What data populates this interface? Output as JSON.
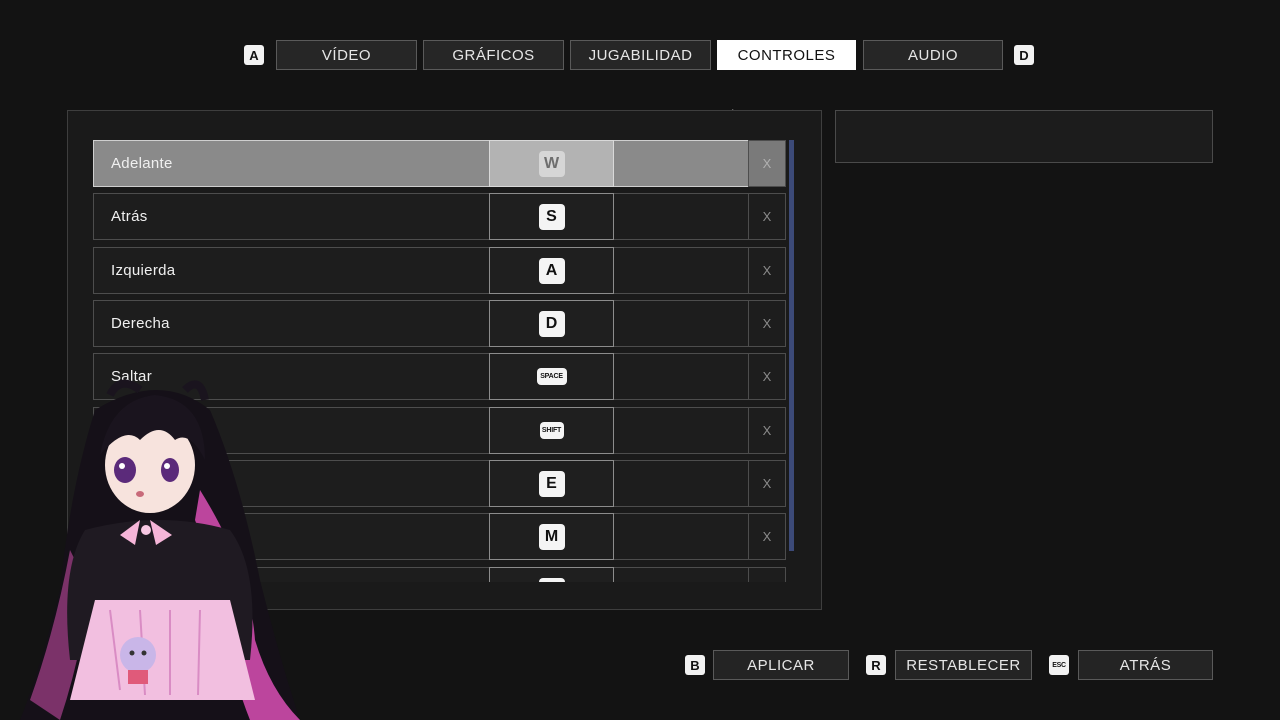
{
  "tabs": {
    "prev_key": "A",
    "next_key": "D",
    "items": [
      {
        "label": "VÍDEO"
      },
      {
        "label": "GRÁFICOS"
      },
      {
        "label": "JUGABILIDAD"
      },
      {
        "label": "CONTROLES",
        "active": true
      },
      {
        "label": "AUDIO"
      }
    ]
  },
  "bindings": [
    {
      "action": "Adelante",
      "key": "W",
      "clear": "X",
      "selected": true
    },
    {
      "action": "Atrás",
      "key": "S",
      "clear": "X"
    },
    {
      "action": "Izquierda",
      "key": "A",
      "clear": "X"
    },
    {
      "action": "Derecha",
      "key": "D",
      "clear": "X"
    },
    {
      "action": "Saltar",
      "key": "SPACE",
      "clear": "X"
    },
    {
      "action": "",
      "key": "SHIFT",
      "clear": "X"
    },
    {
      "action": "",
      "key": "E",
      "clear": "X"
    },
    {
      "action": "",
      "key": "M",
      "clear": "X"
    }
  ],
  "footer": {
    "apply_key": "B",
    "apply_label": "APLICAR",
    "reset_key": "R",
    "reset_label": "RESTABLECER",
    "back_key": "ESC",
    "back_label": "ATRÁS"
  },
  "colors": {
    "background": "#131313",
    "active_tab": "#ffffff",
    "scrollbar": "#3c4a78",
    "avatar_accent": "#e25fc0"
  }
}
